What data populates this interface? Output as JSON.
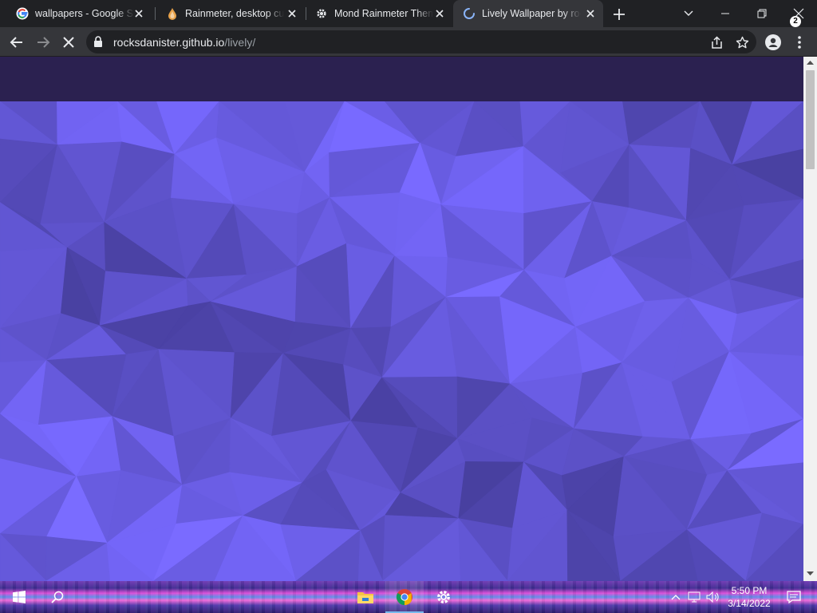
{
  "browser": {
    "tabs": [
      {
        "title": "wallpapers - Google Se",
        "favicon": "google-icon",
        "active": false
      },
      {
        "title": "Rainmeter, desktop cus",
        "favicon": "rainmeter-drop-icon",
        "active": false
      },
      {
        "title": "Mond Rainmeter Them",
        "favicon": "gear-icon",
        "active": false
      },
      {
        "title": "Lively Wallpaper by roc",
        "favicon": "loading-spinner-icon",
        "active": true
      }
    ],
    "address": {
      "host": "rocksdanister.github.io",
      "path": "/lively/"
    }
  },
  "page": {
    "header_color": "#2b2150",
    "hero_color": "#7a6af0"
  },
  "taskbar": {
    "pinned": [
      "file-explorer-icon",
      "chrome-icon",
      "settings-icon"
    ],
    "clock": {
      "time": "5:50 PM",
      "date": "3/14/2022"
    },
    "notification_count": "2"
  }
}
